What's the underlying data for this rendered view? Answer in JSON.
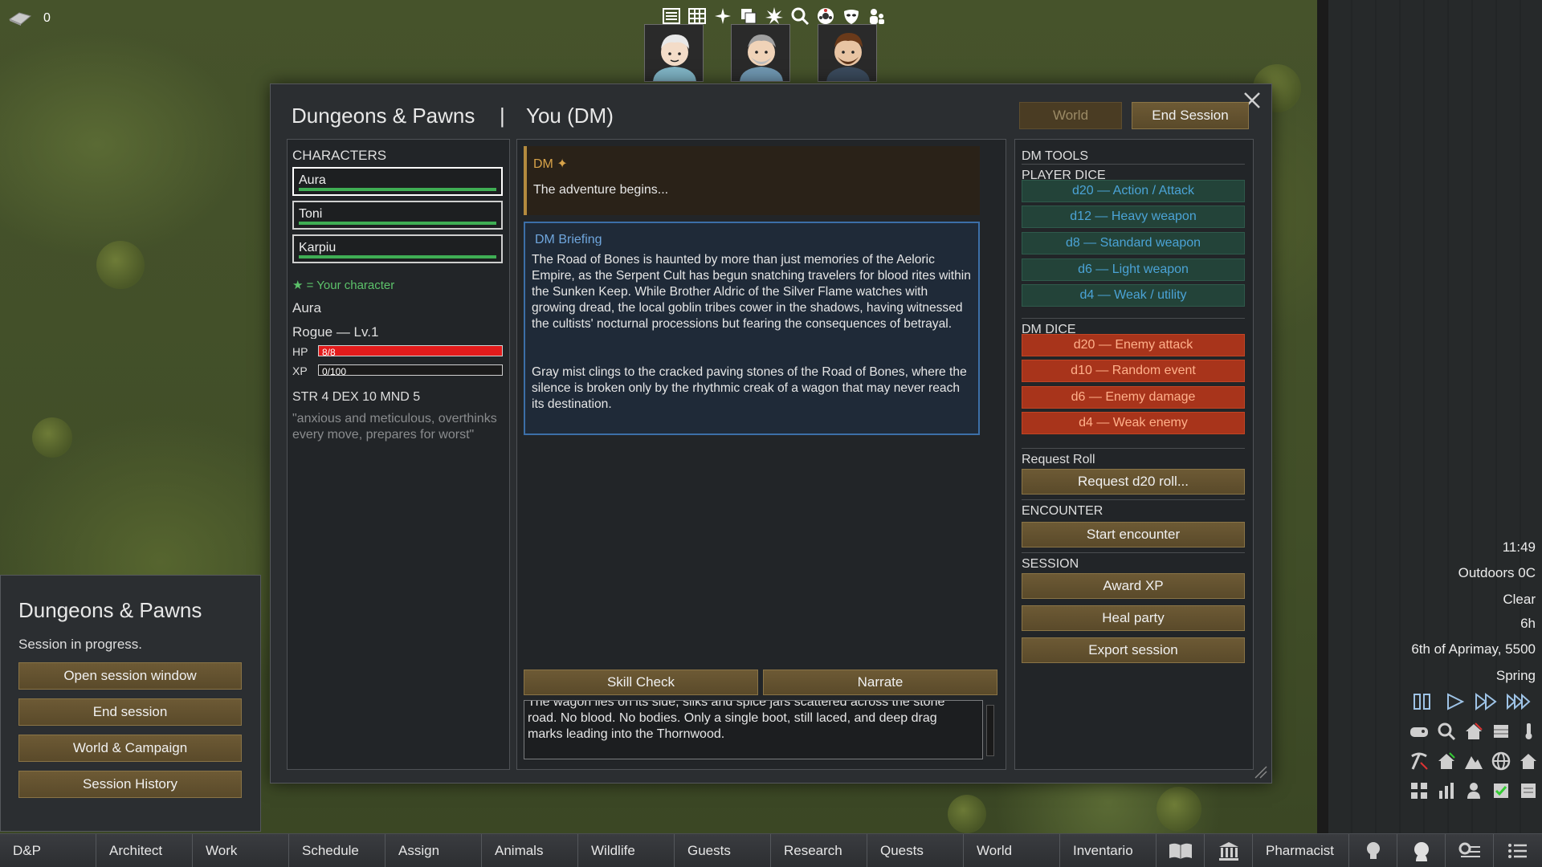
{
  "resource": {
    "icon": "silver-icon",
    "count": "0"
  },
  "top_icons": [
    "list-icon",
    "grid-icon",
    "sparkle-icon",
    "copy-icon",
    "burst-icon",
    "magnifier-icon",
    "wheel-icon",
    "mask-icon",
    "people-icon"
  ],
  "colonists": [
    "colonist-portrait-1",
    "colonist-portrait-2",
    "colonist-portrait-3"
  ],
  "window": {
    "title": "Dungeons & Pawns",
    "separator": "|",
    "role": "You (DM)",
    "world_button": "World",
    "end_session_button": "End Session"
  },
  "characters": {
    "header": "CHARACTERS",
    "list": [
      {
        "name": "Aura",
        "hp_fraction": 1.0
      },
      {
        "name": "Toni",
        "hp_fraction": 1.0
      },
      {
        "name": "Karpiu",
        "hp_fraction": 1.0
      }
    ],
    "legend": "★ = Your character",
    "selected": {
      "name": "Aura",
      "class_level": "Rogue — Lv.1",
      "hp_label": "HP",
      "hp_text": "8/8",
      "hp_fraction": 1.0,
      "xp_label": "XP",
      "xp_text": "0/100",
      "xp_fraction": 0.0,
      "stats": "STR 4 DEX 10 MND 5",
      "quote": "\"anxious and meticulous, overthinks every move, prepares for worst\""
    }
  },
  "log": {
    "dm_message": {
      "who": "DM ✦",
      "text": "The adventure begins..."
    },
    "briefing": {
      "title": "DM Briefing",
      "p1": "The Road of Bones is haunted by more than just memories of the Aeloric Empire, as the Serpent Cult has begun snatching travelers for blood rites within the Sunken Keep. While Brother Aldric of the Silver Flame watches with growing dread, the local goblin tribes cower in the shadows, having witnessed the cultists' nocturnal processions but fearing the consequences of betrayal.",
      "p2": "Gray mist clings to the cracked paving stones of the Road of Bones, where the silence is broken only by the rhythmic creak of a wagon that may never reach its destination."
    },
    "skill_check_button": "Skill Check",
    "narrate_button": "Narrate",
    "input_text": "The wagon lies on its side, silks and spice jars scattered across the stone road. No blood. No bodies. Only a single boot, still laced, and deep drag marks leading into the Thornwood."
  },
  "tools": {
    "header": "DM TOOLS",
    "player_dice_label": "PLAYER DICE",
    "player_dice": [
      "d20 — Action / Attack",
      "d12 — Heavy weapon",
      "d8  — Standard weapon",
      "d6  — Light weapon",
      "d4  — Weak / utility"
    ],
    "dm_dice_label": "DM DICE",
    "dm_dice": [
      "d20 — Enemy attack",
      "d10 — Random event",
      "d6  — Enemy damage",
      "d4  — Weak enemy"
    ],
    "request_roll_label": "Request Roll",
    "request_roll_button": "Request d20 roll...",
    "encounter_label": "ENCOUNTER",
    "start_encounter_button": "Start encounter",
    "session_label": "SESSION",
    "award_xp_button": "Award XP",
    "heal_party_button": "Heal party",
    "export_session_button": "Export session"
  },
  "mini_panel": {
    "title": "Dungeons & Pawns",
    "status": "Session in progress.",
    "buttons": [
      "Open session window",
      "End session",
      "World & Campaign",
      "Session History"
    ]
  },
  "info": {
    "time": "11:49",
    "temperature": "Outdoors 0C",
    "weather": "Clear",
    "hour": "6h",
    "date": "6th of Aprimay, 5500",
    "season": "Spring"
  },
  "speed_controls": [
    "pause-icon",
    "play-icon",
    "fast-icon",
    "superfast-icon"
  ],
  "quick_icons": [
    "gamepad-icon",
    "zoom-icon",
    "roof-icon",
    "zone-icon",
    "temperature-icon",
    "pickaxe-icon",
    "home-icon",
    "mountain-icon",
    "globe-icon",
    "house-icon",
    "grid-icon",
    "chart-icon",
    "pawn-icon",
    "check-icon",
    "note-icon"
  ],
  "tabs": [
    "D&P",
    "Architect",
    "Work",
    "Schedule",
    "Assign",
    "Animals",
    "Wildlife",
    "Guests",
    "Research",
    "Quests",
    "World",
    "Inventario"
  ],
  "tab_pharmacist": "Pharmacist",
  "colors": {
    "accent_gold": "#d8a349",
    "briefing_blue": "#3c6fa8",
    "player_dice_text": "#4ba3d6",
    "dm_dice_bg": "#a8341b",
    "hp_red": "#e31b1b",
    "health_green": "#3fae54"
  }
}
